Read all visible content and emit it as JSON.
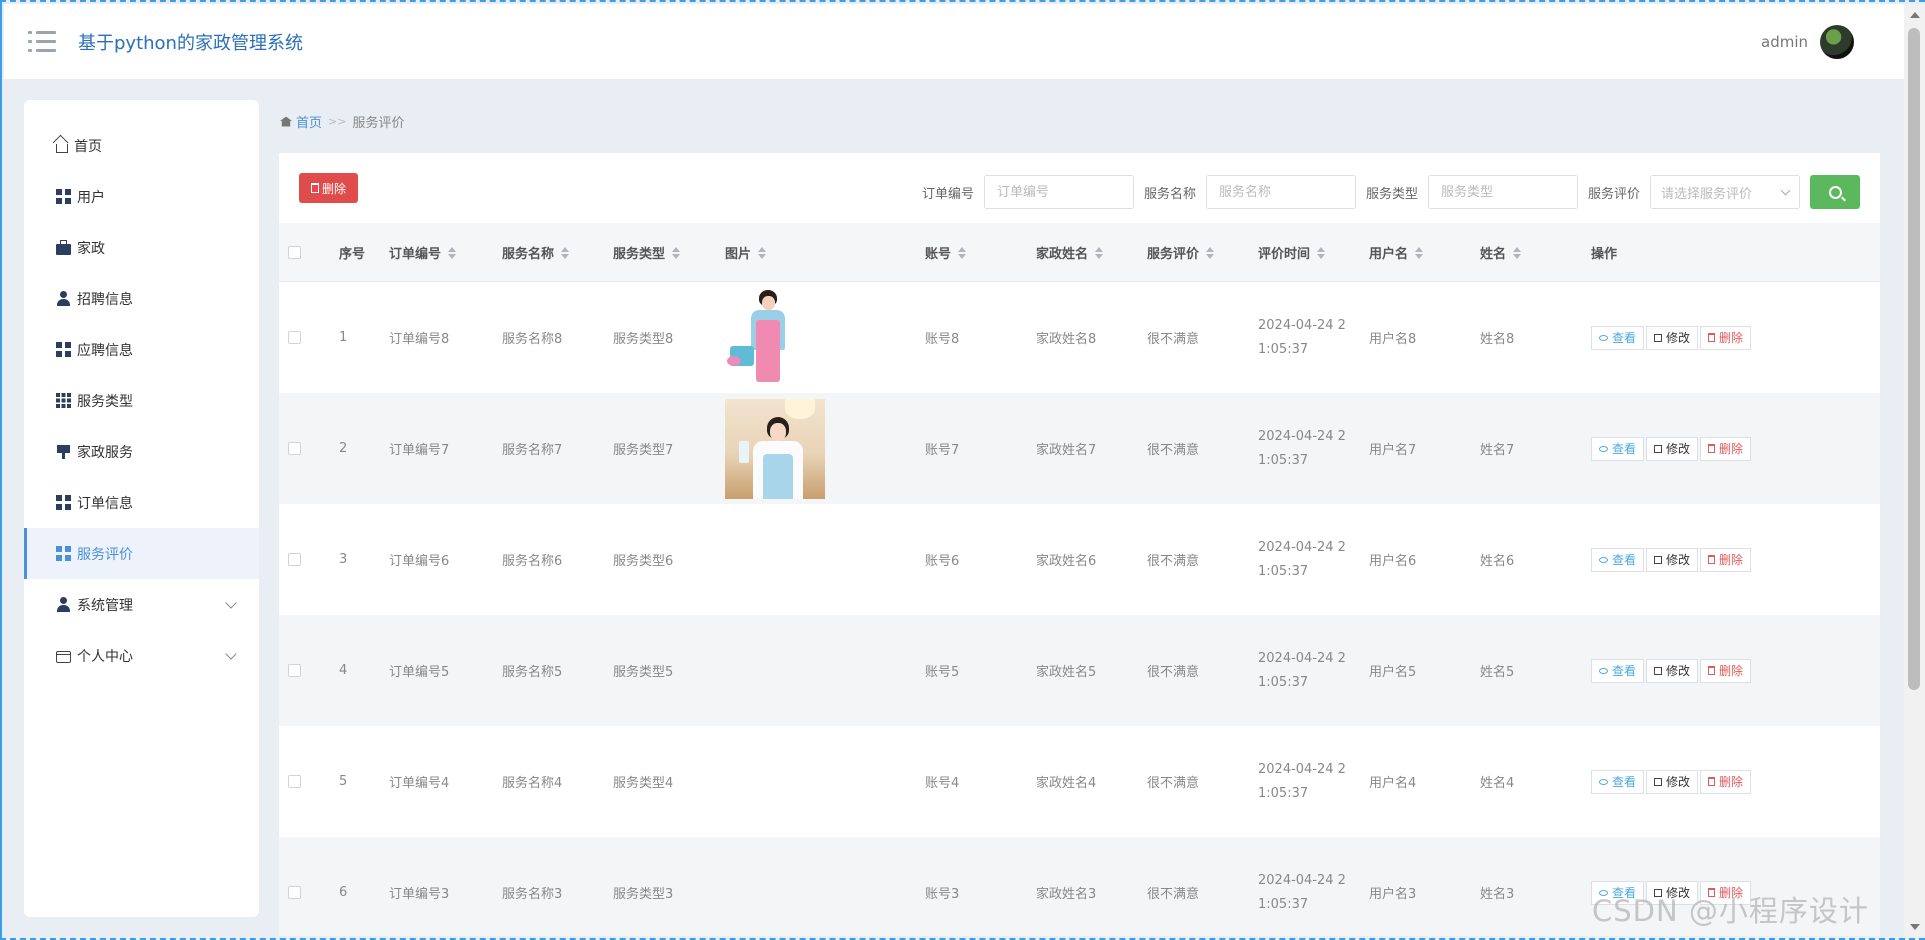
{
  "header": {
    "title": "基于python的家政管理系统",
    "user": "admin"
  },
  "sidebar": {
    "items": [
      {
        "label": "首页",
        "icon": "home-icon"
      },
      {
        "label": "用户",
        "icon": "grid-icon"
      },
      {
        "label": "家政",
        "icon": "briefcase-icon"
      },
      {
        "label": "招聘信息",
        "icon": "user-icon"
      },
      {
        "label": "应聘信息",
        "icon": "grid-icon"
      },
      {
        "label": "服务类型",
        "icon": "grid9-icon"
      },
      {
        "label": "家政服务",
        "icon": "stamp-icon"
      },
      {
        "label": "订单信息",
        "icon": "grid-icon"
      },
      {
        "label": "服务评价",
        "icon": "grid-icon"
      },
      {
        "label": "系统管理",
        "icon": "user-icon"
      },
      {
        "label": "个人中心",
        "icon": "card-icon"
      }
    ]
  },
  "breadcrumb": {
    "home": "首页",
    "separator": ">>",
    "current": "服务评价"
  },
  "toolbar": {
    "delete_label": "删除"
  },
  "search": {
    "order_label": "订单编号",
    "order_placeholder": "订单编号",
    "name_label": "服务名称",
    "name_placeholder": "服务名称",
    "type_label": "服务类型",
    "type_placeholder": "服务类型",
    "rating_label": "服务评价",
    "rating_placeholder": "请选择服务评价"
  },
  "table": {
    "headers": {
      "index": "序号",
      "order": "订单编号",
      "name": "服务名称",
      "type": "服务类型",
      "image": "图片",
      "account": "账号",
      "worker": "家政姓名",
      "rating": "服务评价",
      "time": "评价时间",
      "username": "用户名",
      "realname": "姓名",
      "ops": "操作"
    },
    "rows": [
      {
        "index": "1",
        "order": "订单编号8",
        "name": "服务名称8",
        "type": "服务类型8",
        "account": "账号8",
        "worker": "家政姓名8",
        "rating": "很不满意",
        "time1": "2024-04-24 2",
        "time2": "1:05:37",
        "username": "用户名8",
        "realname": "姓名8"
      },
      {
        "index": "2",
        "order": "订单编号7",
        "name": "服务名称7",
        "type": "服务类型7",
        "account": "账号7",
        "worker": "家政姓名7",
        "rating": "很不满意",
        "time1": "2024-04-24 2",
        "time2": "1:05:37",
        "username": "用户名7",
        "realname": "姓名7"
      },
      {
        "index": "3",
        "order": "订单编号6",
        "name": "服务名称6",
        "type": "服务类型6",
        "account": "账号6",
        "worker": "家政姓名6",
        "rating": "很不满意",
        "time1": "2024-04-24 2",
        "time2": "1:05:37",
        "username": "用户名6",
        "realname": "姓名6"
      },
      {
        "index": "4",
        "order": "订单编号5",
        "name": "服务名称5",
        "type": "服务类型5",
        "account": "账号5",
        "worker": "家政姓名5",
        "rating": "很不满意",
        "time1": "2024-04-24 2",
        "time2": "1:05:37",
        "username": "用户名5",
        "realname": "姓名5"
      },
      {
        "index": "5",
        "order": "订单编号4",
        "name": "服务名称4",
        "type": "服务类型4",
        "account": "账号4",
        "worker": "家政姓名4",
        "rating": "很不满意",
        "time1": "2024-04-24 2",
        "time2": "1:05:37",
        "username": "用户名4",
        "realname": "姓名4"
      },
      {
        "index": "6",
        "order": "订单编号3",
        "name": "服务名称3",
        "type": "服务类型3",
        "account": "账号3",
        "worker": "家政姓名3",
        "rating": "很不满意",
        "time1": "2024-04-24 2",
        "time2": "1:05:37",
        "username": "用户名3",
        "realname": "姓名3"
      }
    ],
    "actions": {
      "view": "查看",
      "edit": "修改",
      "delete": "删除"
    }
  },
  "watermark": "CSDN @小程序设计",
  "colors": {
    "accent": "#4a90d9",
    "danger": "#e04b4b",
    "success": "#5cb85c"
  }
}
